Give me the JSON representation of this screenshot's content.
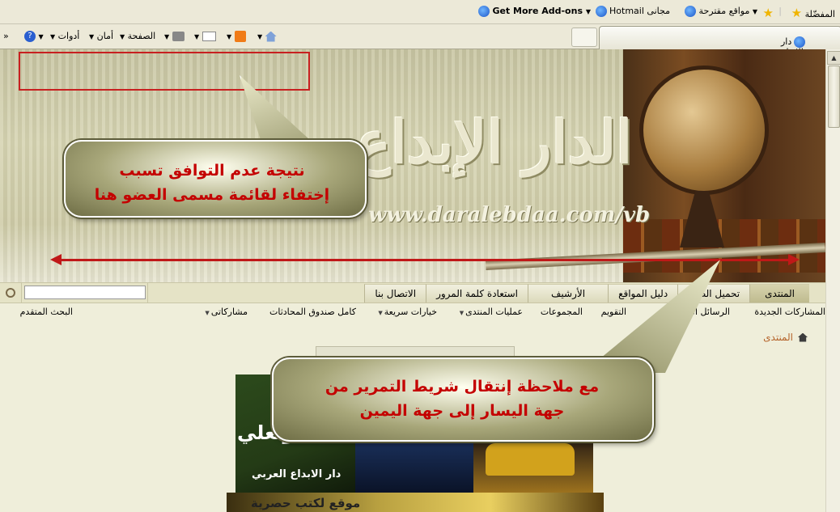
{
  "favorites_bar": {
    "favorites_label": "المفضّلة",
    "suggested_sites": "مواقع مقترحة",
    "hotmail": "Hotmail مجانى",
    "addons": "Get More Add-ons"
  },
  "command_bar": {
    "tab_title": "دار الإبداع العربي",
    "tools": "أدوات",
    "safety": "أمان",
    "page": "الصفحة",
    "chevron": "»"
  },
  "banner": {
    "logo_text": "الدار الإبداع",
    "url": "www.daralebdaa.com/vb"
  },
  "annotations": {
    "bubble1_line1": "نتيجة عدم التوافق تسبب",
    "bubble1_line2": "إختفاء لقائمة مسمى العضو هنا",
    "bubble2_line1": "مع ملاحظة إنتقال شريط التمرير من",
    "bubble2_line2": "جهة اليسار إلى جهة اليمين",
    "arrow_color": "#c01818"
  },
  "navbar": {
    "tabs": [
      "المنتدى",
      "تحميل الصور",
      "دليل المواقع",
      "الأرشيف",
      "استعادة كلمة المرور",
      "الاتصال بنا"
    ],
    "active_tab": "المنتدى",
    "search_value": ""
  },
  "subnav": {
    "items": [
      "المشاركات الجديدة",
      "الرسائل الخاصة",
      "التقويم",
      "المجموعات",
      "عمليات المنتدى",
      "خيارات سريعة",
      "كامل صندوق المحادثات",
      "مشاركاتى",
      "البحث المتقدم"
    ]
  },
  "breadcrumb": {
    "label": "المنتدى"
  },
  "gallery": {
    "panel1_label": "دار الابداع العربي",
    "panel1_side": "وتعلي",
    "bottom_text": "موقع لكتب حصرية"
  },
  "colors": {
    "annotation_red": "#c40000",
    "link_orange": "#b5632a",
    "navbar_bg": "#e5e3c6"
  }
}
